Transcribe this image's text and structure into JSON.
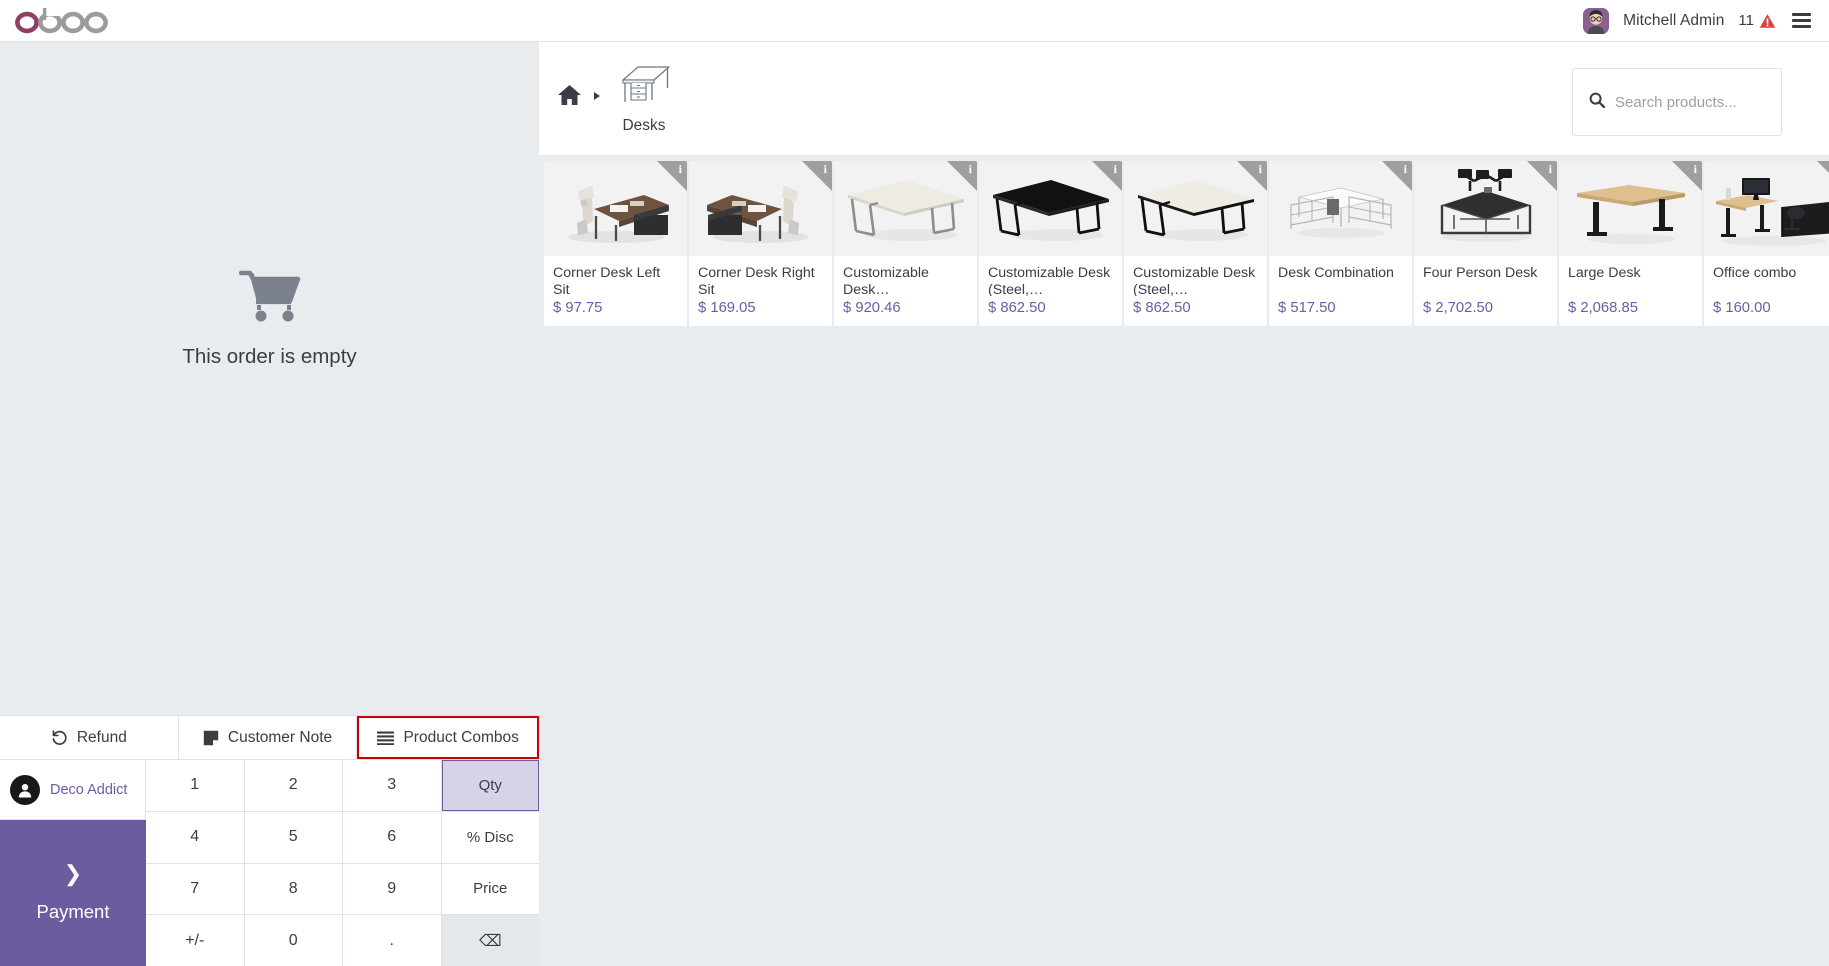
{
  "navbar": {
    "brand": "odoo",
    "user_name": "Mitchell Admin",
    "notification_count": "11",
    "icons": {
      "avatar": "user-avatar",
      "warning": "warning-triangle-icon",
      "menu": "hamburger-menu-icon"
    }
  },
  "order_panel": {
    "empty_message": "This order is empty",
    "cart_icon": "shopping-cart-icon"
  },
  "control_buttons": [
    {
      "label": "Refund",
      "icon": "undo-icon",
      "highlighted": false
    },
    {
      "label": "Customer Note",
      "icon": "sticky-note-icon",
      "highlighted": false
    },
    {
      "label": "Product Combos",
      "icon": "list-bars-icon",
      "highlighted": true
    }
  ],
  "customer": {
    "name": "Deco Addict",
    "icon": "person-icon"
  },
  "payment": {
    "label": "Payment",
    "chevron": "chevron-right-icon"
  },
  "numpad": {
    "keys": [
      {
        "label": "1",
        "type": "digit"
      },
      {
        "label": "2",
        "type": "digit"
      },
      {
        "label": "3",
        "type": "digit"
      },
      {
        "label": "Qty",
        "type": "mode",
        "selected": true
      },
      {
        "label": "4",
        "type": "digit"
      },
      {
        "label": "5",
        "type": "digit"
      },
      {
        "label": "6",
        "type": "digit"
      },
      {
        "label": "% Disc",
        "type": "mode",
        "selected": false
      },
      {
        "label": "7",
        "type": "digit"
      },
      {
        "label": "8",
        "type": "digit"
      },
      {
        "label": "9",
        "type": "digit"
      },
      {
        "label": "Price",
        "type": "mode",
        "selected": false
      },
      {
        "label": "+/-",
        "type": "sign"
      },
      {
        "label": "0",
        "type": "digit"
      },
      {
        "label": ".",
        "type": "digit"
      },
      {
        "label": "⌫",
        "type": "backspace"
      }
    ]
  },
  "breadcrumb": {
    "home_icon": "home-icon",
    "caret_icon": "caret-right-icon",
    "category": "Desks",
    "category_icon": "desk-icon"
  },
  "search": {
    "placeholder": "Search products...",
    "icon": "search-icon"
  },
  "products": [
    {
      "name": "Corner Desk Left Sit",
      "price": "$ 97.75",
      "image": "corner-desk-left-sit",
      "info_badge": "i"
    },
    {
      "name": "Corner Desk Right Sit",
      "price": "$ 169.05",
      "image": "corner-desk-right-sit",
      "info_badge": "i"
    },
    {
      "name": "Customizable Desk…",
      "price": "$ 920.46",
      "image": "customizable-desk-white",
      "info_badge": "i"
    },
    {
      "name": "Customizable Desk (Steel,…",
      "price": "$ 862.50",
      "image": "customizable-desk-black",
      "info_badge": "i"
    },
    {
      "name": "Customizable Desk (Steel,…",
      "price": "$ 862.50",
      "image": "customizable-desk-steel-white",
      "info_badge": "i"
    },
    {
      "name": "Desk Combination",
      "price": "$ 517.50",
      "image": "desk-combination",
      "info_badge": "i"
    },
    {
      "name": "Four Person Desk",
      "price": "$ 2,702.50",
      "image": "four-person-desk",
      "info_badge": "i"
    },
    {
      "name": "Large Desk",
      "price": "$ 2,068.85",
      "image": "large-desk",
      "info_badge": "i"
    },
    {
      "name": "Office combo",
      "price": "$ 160.00",
      "image": "office-combo",
      "info_badge": "i"
    }
  ],
  "colors": {
    "brand_purple": "#714B67",
    "accent_purple": "#6c5b9e",
    "price_purple": "#6f5aa8",
    "highlight_red": "#cc0000",
    "panel_bg": "#e9ecef",
    "text": "#3c3c44"
  }
}
